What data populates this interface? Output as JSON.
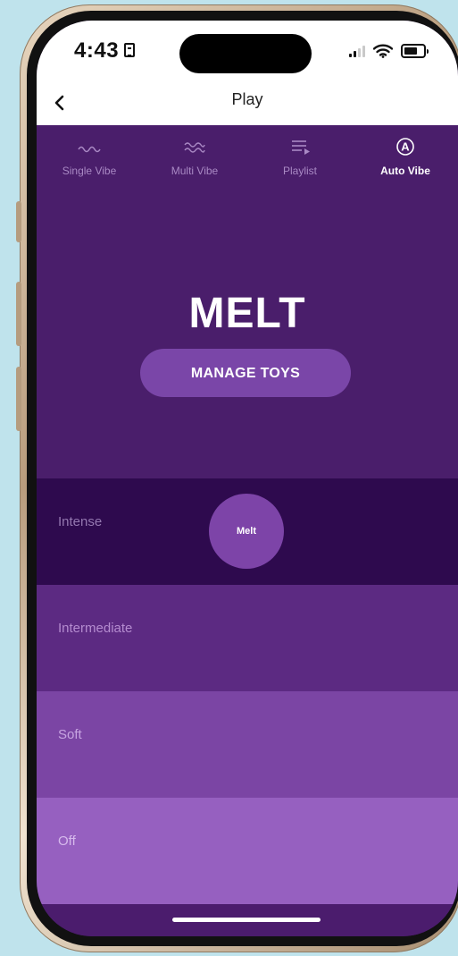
{
  "status_bar": {
    "time": "4:43"
  },
  "header": {
    "title": "Play"
  },
  "tabs": [
    {
      "label": "Single Vibe",
      "icon": "single-wave-icon"
    },
    {
      "label": "Multi Vibe",
      "icon": "multi-wave-icon"
    },
    {
      "label": "Playlist",
      "icon": "playlist-icon"
    },
    {
      "label": "Auto Vibe",
      "icon": "auto-a-icon"
    }
  ],
  "active_tab": "Auto Vibe",
  "device": {
    "name": "MELT",
    "manage_label": "MANAGE TOYS"
  },
  "intensity_levels": [
    {
      "label": "Intense",
      "color": "#2e0a4e"
    },
    {
      "label": "Intermediate",
      "color": "#5c2a82"
    },
    {
      "label": "Soft",
      "color": "#7b45a4"
    },
    {
      "label": "Off",
      "color": "#9660c0"
    }
  ],
  "handle": {
    "label": "Melt",
    "level": "Intense"
  },
  "colors": {
    "accent": "#7a46a8",
    "background": "#4f1f70",
    "frame": "#bfe3ec"
  }
}
